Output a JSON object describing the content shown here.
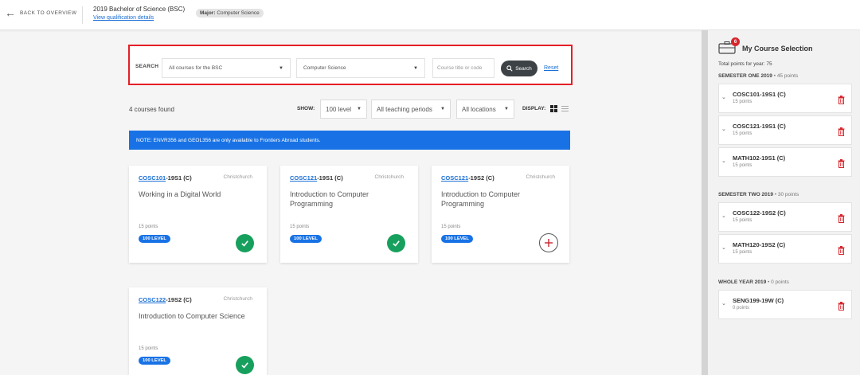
{
  "header": {
    "back_label": "BACK TO OVERVIEW",
    "qualification": "2019 Bachelor of Science (BSC)",
    "view_details": "View qualification details",
    "major_label": "Major:",
    "major_value": "Computer Science"
  },
  "search": {
    "label": "SEARCH",
    "scope": "All courses for the BSC",
    "subject": "Computer Science",
    "placeholder": "Course title or code",
    "button": "Search",
    "reset": "Reset"
  },
  "filters": {
    "found": "4 courses found",
    "show_label": "SHOW:",
    "level": "100 level",
    "period": "All teaching periods",
    "location": "All locations",
    "display_label": "DISPLAY:"
  },
  "note": "NOTE: ENVR356 and GEOL356 are only available to Frontiers Abroad students.",
  "courses": [
    {
      "code_link": "COSC101",
      "code_rest": "-19S1 (C)",
      "location": "Christchurch",
      "title": "Working in a Digital World",
      "points": "15 points",
      "level": "100 LEVEL",
      "status": "selected"
    },
    {
      "code_link": "COSC121",
      "code_rest": "-19S1 (C)",
      "location": "Christchurch",
      "title": "Introduction to Computer Programming",
      "points": "15 points",
      "level": "100 LEVEL",
      "status": "selected"
    },
    {
      "code_link": "COSC121",
      "code_rest": "-19S2 (C)",
      "location": "Christchurch",
      "title": "Introduction to Computer Programming",
      "points": "15 points",
      "level": "100 LEVEL",
      "status": "add"
    },
    {
      "code_link": "COSC122",
      "code_rest": "-19S2 (C)",
      "location": "Christchurch",
      "title": "Introduction to Computer Science",
      "points": "15 points",
      "level": "100 LEVEL",
      "status": "selected"
    }
  ],
  "selection": {
    "badge": "6",
    "title": "My Course Selection",
    "total": "Total points for year: 75",
    "semesters": [
      {
        "name": "SEMESTER ONE 2019",
        "points": "• 45 points",
        "items": [
          {
            "code": "COSC101-19S1 (C)",
            "points": "15 points"
          },
          {
            "code": "COSC121-19S1 (C)",
            "points": "15 points"
          },
          {
            "code": "MATH102-19S1 (C)",
            "points": "15 points"
          }
        ]
      },
      {
        "name": "SEMESTER TWO 2019",
        "points": "• 30 points",
        "items": [
          {
            "code": "COSC122-19S2 (C)",
            "points": "15 points"
          },
          {
            "code": "MATH120-19S2 (C)",
            "points": "15 points"
          }
        ]
      },
      {
        "name": "WHOLE YEAR 2019",
        "points": "• 0 points",
        "items": [
          {
            "code": "SENG199-19W (C)",
            "points": "0 points"
          }
        ]
      }
    ]
  },
  "colors": {
    "accent": "#1872e6",
    "highlight_border": "#e41f26",
    "success": "#17a05d",
    "danger": "#d7262d"
  }
}
